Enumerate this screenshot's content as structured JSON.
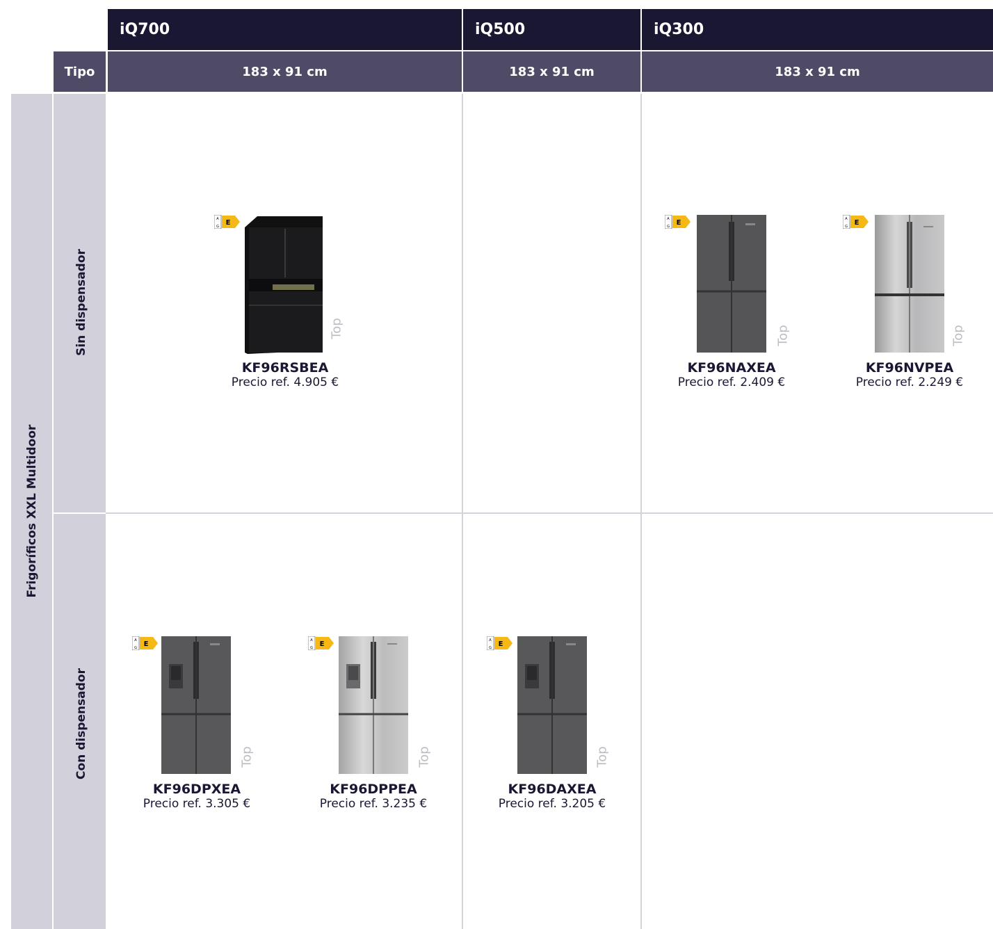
{
  "header": {
    "series": [
      "iQ700",
      "iQ500",
      "iQ300"
    ],
    "tipo_label": "Tipo",
    "sizes": [
      "183 x 91 cm",
      "183 x 91 cm",
      "183 x 91 cm"
    ]
  },
  "category_label": "Frigoríficos XXL Multidoor",
  "rows": [
    {
      "label": "Sin dispensador",
      "products": [
        {
          "model": "KF96RSBEA",
          "price": "Precio ref. 4.905 €",
          "energy_class": "E",
          "badge": "Top",
          "finish": "black-glass"
        },
        {
          "model": "KF96NAXEA",
          "price": "Precio ref. 2.409 €",
          "energy_class": "E",
          "badge": "Top",
          "finish": "dark-inox"
        },
        {
          "model": "KF96NVPEA",
          "price": "Precio ref. 2.249 €",
          "energy_class": "E",
          "badge": "Top",
          "finish": "inox"
        }
      ]
    },
    {
      "label": "Con dispensador",
      "products": [
        {
          "model": "KF96DPXEA",
          "price": "Precio ref. 3.305 €",
          "energy_class": "E",
          "badge": "Top",
          "finish": "dark-inox-dispenser"
        },
        {
          "model": "KF96DPPEA",
          "price": "Precio ref. 3.235 €",
          "energy_class": "E",
          "badge": "Top",
          "finish": "inox-dispenser"
        },
        {
          "model": "KF96DAXEA",
          "price": "Precio ref. 3.205 €",
          "energy_class": "E",
          "badge": "Top",
          "finish": "dark-inox-dispenser"
        }
      ]
    }
  ],
  "colors": {
    "header_dark": "#1a1733",
    "header_purple": "#4f4b66",
    "side_light": "#d2d0db",
    "energy_E": "#f5b815"
  }
}
